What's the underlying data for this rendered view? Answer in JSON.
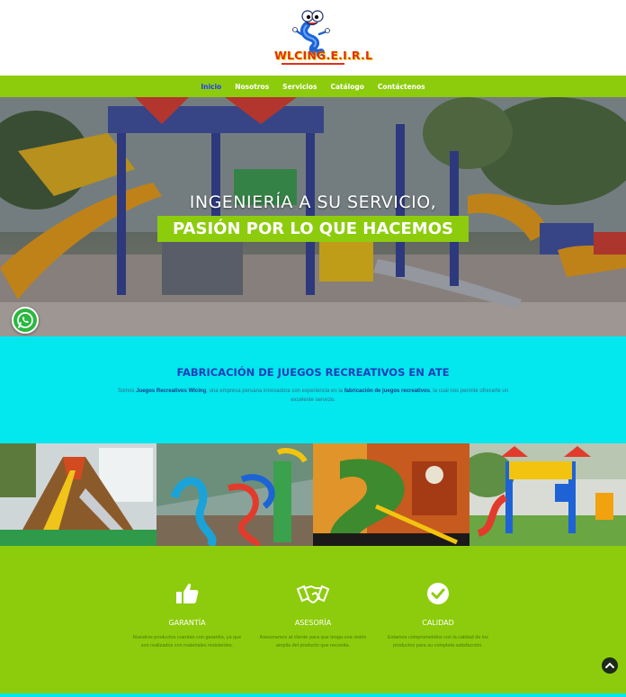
{
  "brand": {
    "logo_text": "WLCING.E.I.R.L"
  },
  "nav": {
    "items": [
      {
        "label": "Inicio",
        "active": true
      },
      {
        "label": "Nosotros",
        "active": false
      },
      {
        "label": "Servicios",
        "active": false
      },
      {
        "label": "Catálogo",
        "active": false
      },
      {
        "label": "Contáctenos",
        "active": false
      }
    ]
  },
  "hero": {
    "line1": "INGENIERÍA A SU SERVICIO,",
    "line2": "PASIÓN POR LO QUE HACEMOS"
  },
  "about": {
    "title": "FABRICACIÓN DE JUEGOS RECREATIVOS EN ATE",
    "text_1": "Somos ",
    "text_bold_1": "Juegos Recreativos Wlcing",
    "text_2": ", una empresa peruana innovadora con experiencia en la ",
    "text_bold_2": "fabricación de juegos recreativos",
    "text_3": ", la cual nos permite ofrecerle un excelente servicio."
  },
  "features": [
    {
      "icon": "thumbs-up-icon",
      "title": "GARANTÍA",
      "text": "Nuestros productos cuentan con garantía, ya que son realizados con materiales resistentes."
    },
    {
      "icon": "handshake-icon",
      "title": "ASESORÍA",
      "text": "Asesoramos al cliente para que tenga una visión amplia del producto que necesita."
    },
    {
      "icon": "check-circle-icon",
      "title": "CALIDAD",
      "text": "Estamos comprometidos con la calidad de los productos para su completa satisfacción."
    }
  ],
  "colors": {
    "green": "#8dcc0c",
    "cyan": "#03e7ee",
    "nav_active": "#1f3cff",
    "title_blue": "#1a3fb8"
  }
}
